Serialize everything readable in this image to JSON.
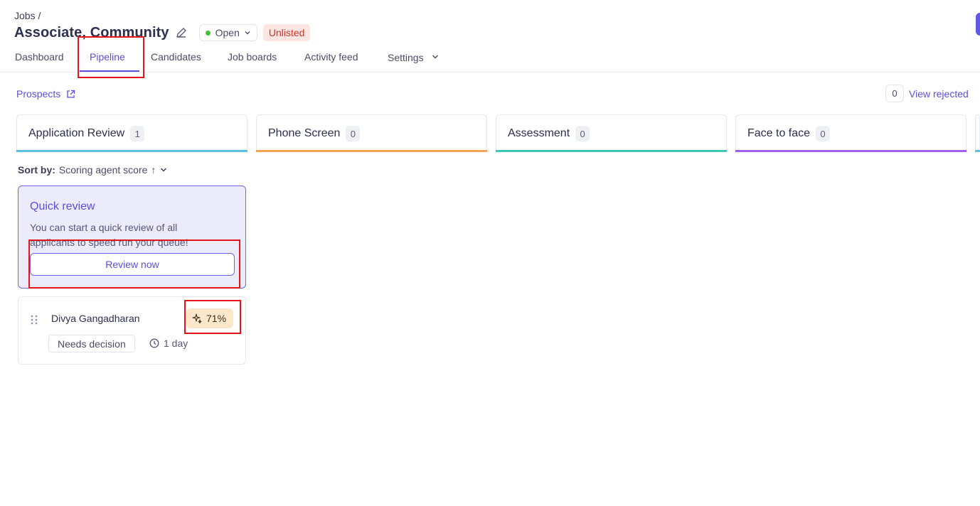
{
  "header": {
    "breadcrumb": "Jobs /",
    "job_title": "Associate, Community",
    "status": "Open",
    "visibility_badge": "Unlisted",
    "colors": {
      "accent": "#5b4fe0",
      "status_open": "#42c034",
      "unlisted_text": "#c8372a",
      "unlisted_bg": "#fde5e1"
    }
  },
  "tabs": [
    {
      "label": "Dashboard"
    },
    {
      "label": "Pipeline",
      "active": true
    },
    {
      "label": "Candidates"
    },
    {
      "label": "Job boards"
    },
    {
      "label": "Activity feed"
    },
    {
      "label": "Settings"
    }
  ],
  "toolbar": {
    "prospects_label": "Prospects",
    "rejected_count": "0",
    "view_rejected_label": "View rejected"
  },
  "stages": [
    {
      "name": "Application Review",
      "count": "1",
      "color": "#5bc0eb"
    },
    {
      "name": "Phone Screen",
      "count": "0",
      "color": "#f4a259"
    },
    {
      "name": "Assessment",
      "count": "0",
      "color": "#3cc8b4"
    },
    {
      "name": "Face to face",
      "count": "0",
      "color": "#a55eea"
    }
  ],
  "sort": {
    "label": "Sort by:",
    "value": "Scoring agent score",
    "direction": "↑"
  },
  "quick_review": {
    "title": "Quick review",
    "text": "You can start a quick review of all applicants to speed run your queue!",
    "button_label": "Review now"
  },
  "candidate": {
    "name": "Divya Gangadharan",
    "score": "71%",
    "status_tag": "Needs decision",
    "time_in_stage": "1 day"
  }
}
